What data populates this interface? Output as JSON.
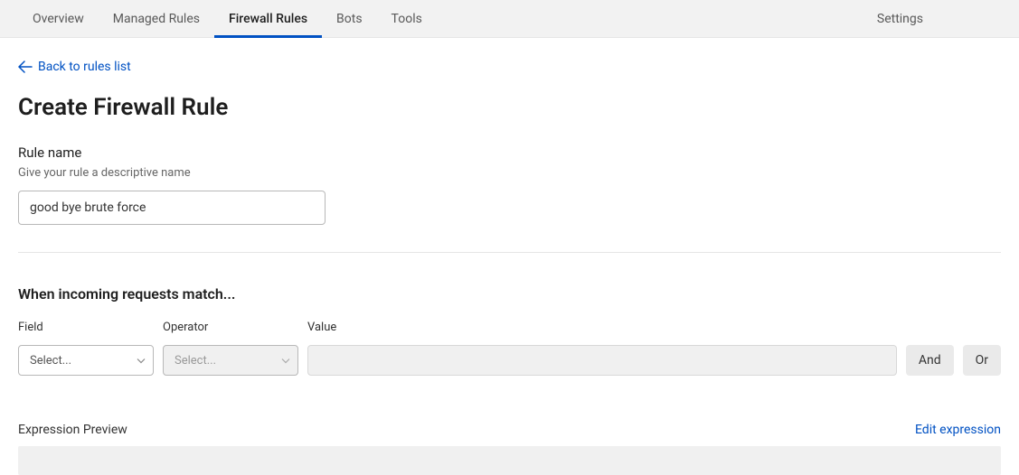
{
  "tabs": {
    "left": [
      {
        "label": "Overview",
        "active": false
      },
      {
        "label": "Managed Rules",
        "active": false
      },
      {
        "label": "Firewall Rules",
        "active": true
      },
      {
        "label": "Bots",
        "active": false
      },
      {
        "label": "Tools",
        "active": false
      }
    ],
    "right": [
      {
        "label": "Settings"
      }
    ]
  },
  "backLink": "Back to rules list",
  "pageTitle": "Create Firewall Rule",
  "ruleName": {
    "label": "Rule name",
    "help": "Give your rule a descriptive name",
    "value": "good bye brute force"
  },
  "match": {
    "heading": "When incoming requests match...",
    "fieldLabel": "Field",
    "operatorLabel": "Operator",
    "valueLabel": "Value",
    "fieldPlaceholder": "Select...",
    "operatorPlaceholder": "Select...",
    "valueInput": "",
    "andLabel": "And",
    "orLabel": "Or"
  },
  "expression": {
    "label": "Expression Preview",
    "editLabel": "Edit expression"
  }
}
